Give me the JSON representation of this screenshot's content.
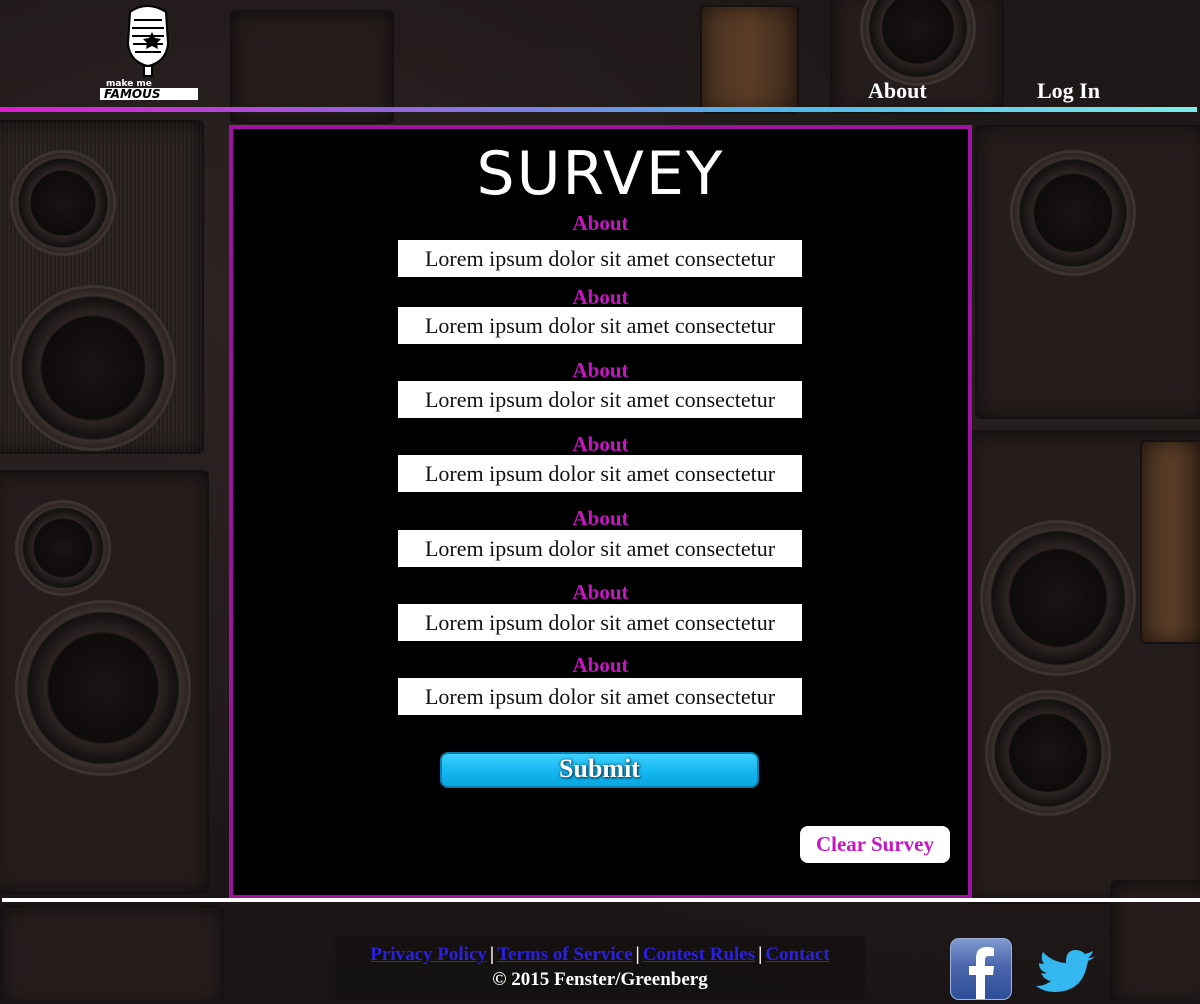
{
  "brand": {
    "logo_line1": "make me",
    "logo_line2": "FAMOUS"
  },
  "nav": {
    "about": "About",
    "login": "Log In"
  },
  "survey": {
    "title": "SURVEY",
    "questions": [
      {
        "label": "About",
        "value": "Lorem ipsum dolor sit amet consectetur"
      },
      {
        "label": "About",
        "value": "Lorem ipsum dolor sit amet consectetur"
      },
      {
        "label": "About",
        "value": "Lorem ipsum dolor sit amet consectetur"
      },
      {
        "label": "About",
        "value": "Lorem ipsum dolor sit amet consectetur"
      },
      {
        "label": "About",
        "value": "Lorem ipsum dolor sit amet consectetur"
      },
      {
        "label": "About",
        "value": "Lorem ipsum dolor sit amet consectetur"
      },
      {
        "label": "About",
        "value": "Lorem ipsum dolor sit amet consectetur"
      }
    ],
    "submit_label": "Submit",
    "clear_label": "Clear Survey"
  },
  "footer": {
    "links": [
      "Privacy Policy",
      "Terms of Service",
      "Contest Rules",
      "Contact"
    ],
    "separator": "|",
    "copyright": "© 2015 Fenster/Greenberg"
  },
  "social": {
    "facebook_icon": "facebook-icon",
    "twitter_icon": "twitter-icon"
  },
  "colors": {
    "accent_magenta": "#c616c2",
    "panel_border": "#9e12a2",
    "submit_blue": "#14b6f0",
    "link_blue": "#2a20e0"
  }
}
